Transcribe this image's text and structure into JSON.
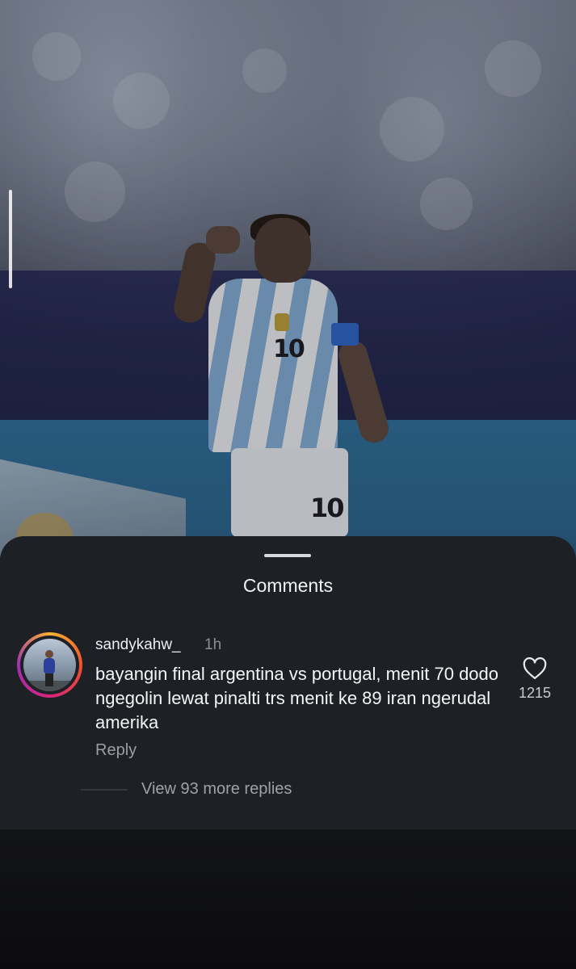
{
  "sheet": {
    "title": "Comments"
  },
  "comment": {
    "username": "sandykahw_",
    "time": "1h",
    "text": "bayangin final argentina vs portugal, menit 70 dodo ngegolin lewat pinalti trs menit ke 89 iran ngerudal amerika",
    "reply_label": "Reply",
    "like_count": "1215",
    "view_replies_label": "View 93 more replies"
  },
  "photo": {
    "shirt_number": "10",
    "shorts_number": "10"
  },
  "icons": {
    "like": "heart-outline-icon",
    "avatar_ring": "story-ring-gradient"
  },
  "colors": {
    "sheet_background": "#1d2024",
    "text_primary": "#f4f5f7",
    "text_secondary": "#9a9ea5",
    "ring_start": "#f8b133",
    "ring_end": "#a12fb4"
  }
}
